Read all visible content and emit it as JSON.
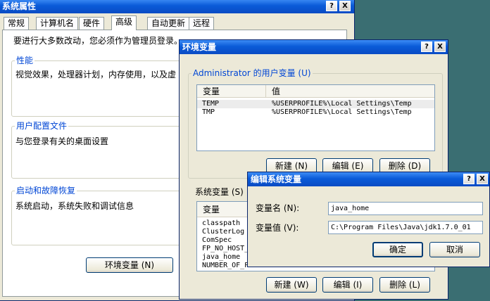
{
  "sys_props": {
    "title": "系统属性",
    "help_btn": "?",
    "close_btn": "X",
    "tabs": [
      "常规",
      "计算机名",
      "硬件",
      "高级",
      "自动更新",
      "远程"
    ],
    "notice": "要进行大多数改动，您必须作为管理员登录。",
    "perf_label": "性能",
    "perf_desc": "视觉效果，处理器计划，内存使用，以及虚",
    "profile_label": "用户配置文件",
    "profile_desc": "与您登录有关的桌面设置",
    "startup_label": "启动和故障恢复",
    "startup_desc": "系统启动，系统失败和调试信息",
    "env_button": "环境变量 (N)"
  },
  "env_vars": {
    "title": "环境变量",
    "help_btn": "?",
    "close_btn": "X",
    "user_vars_label": "Administrator 的用户变量 (U)",
    "col_var": "变量",
    "col_val": "值",
    "user_vars": [
      {
        "name": "TEMP",
        "value": "%USERPROFILE%\\Local Settings\\Temp"
      },
      {
        "name": "TMP",
        "value": "%USERPROFILE%\\Local Settings\\Temp"
      }
    ],
    "user_buttons": [
      "新建 (N)",
      "编辑 (E)",
      "删除 (D)"
    ],
    "sys_vars_label": "系统变量 (S)",
    "sys_vars": [
      "classpath",
      "ClusterLog",
      "ComSpec",
      "FP_NO_HOST_C",
      "java_home",
      "NUMBER_OF_PR"
    ],
    "sys_buttons": [
      "新建 (W)",
      "编辑 (I)",
      "删除 (L)"
    ]
  },
  "edit_var": {
    "title": "编辑系统变量",
    "help_btn": "?",
    "close_btn": "X",
    "name_label": "变量名 (N):",
    "name_value": "java_home",
    "value_label": "变量值 (V):",
    "value_value": "C:\\Program Files\\Java\\jdk1.7.0_01",
    "ok_button": "确定",
    "cancel_button": "取消"
  }
}
